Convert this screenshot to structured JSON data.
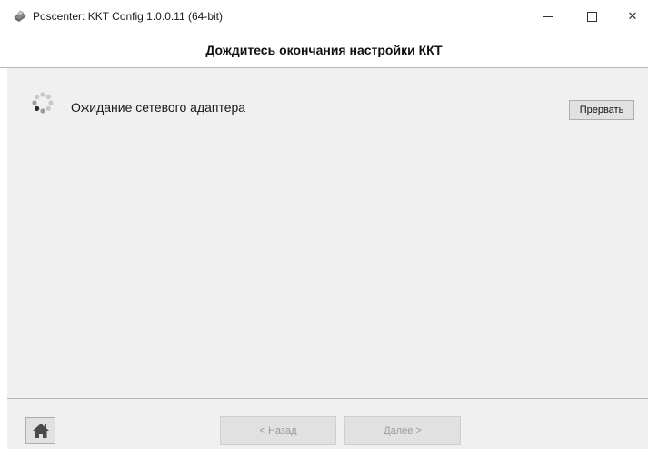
{
  "window": {
    "title": "Poscenter: KKT Config 1.0.0.11 (64-bit)",
    "icons": {
      "app": "printer-icon",
      "minimize": "minimize-icon",
      "maximize": "maximize-icon",
      "close": "close-icon"
    },
    "close_glyph": "✕"
  },
  "header": {
    "title": "Дождитесь окончания настройки ККТ"
  },
  "main": {
    "status_text": "Ожидание сетевого адаптера",
    "spinner_icon": "loading-spinner-icon",
    "abort_label": "Прервать"
  },
  "footer": {
    "home_icon": "home-icon",
    "back_label": "< Назад",
    "next_label": "Далее >",
    "back_enabled": false,
    "next_enabled": false
  },
  "colors": {
    "content_bg": "#f0f0f0",
    "disabled_text": "#9a9a9a"
  }
}
